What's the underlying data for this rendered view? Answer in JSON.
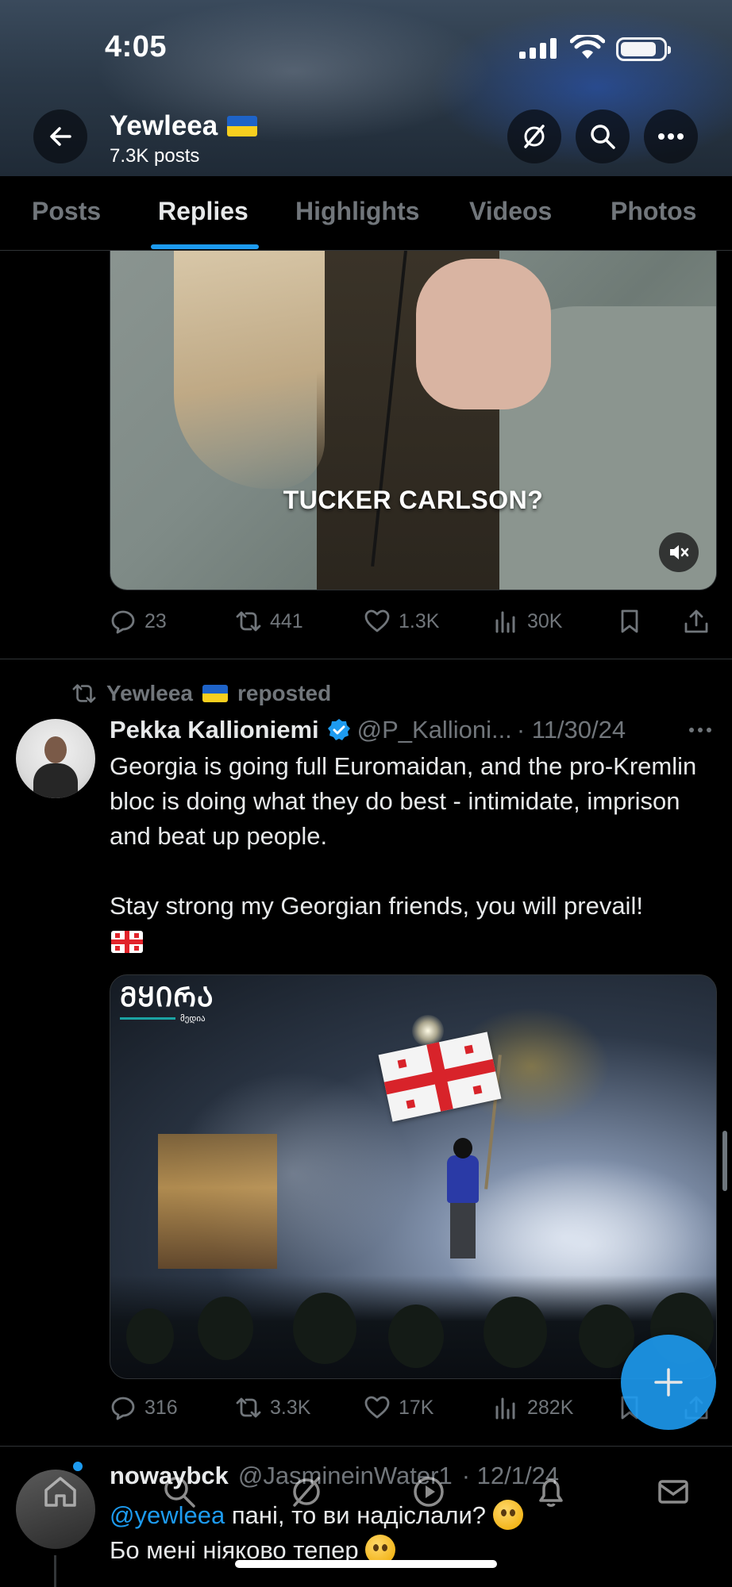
{
  "status_bar": {
    "time": "4:05"
  },
  "profile": {
    "name": "Yewleea",
    "posts_count": "7.3K posts"
  },
  "tabs": [
    {
      "label": "Posts",
      "active": false
    },
    {
      "label": "Replies",
      "active": true
    },
    {
      "label": "Highlights",
      "active": false
    },
    {
      "label": "Videos",
      "active": false
    },
    {
      "label": "Photos",
      "active": false
    }
  ],
  "post1": {
    "video_caption": "TUCKER CARLSON?",
    "replies": "23",
    "reposts": "441",
    "likes": "1.3K",
    "views": "30K"
  },
  "post2": {
    "repost_label": "Yewleea",
    "repost_suffix": "reposted",
    "author": "Pekka Kallioniemi",
    "handle": "@P_Kallioni...",
    "date": "· 11/30/24",
    "text_p1": "Georgia is going full Euromaidan, and the pro-Kremlin bloc is doing what they do best - intimidate, imprison and beat up people.",
    "text_p2": "Stay strong my Georgian friends, you will prevail!",
    "image_logo_text": "ᲛᲧᲘᲠᲐ",
    "image_logo_sub": "მედია",
    "replies": "316",
    "reposts": "3.3K",
    "likes": "17K",
    "views": "282K"
  },
  "post3": {
    "author": "nowaybck",
    "handle": "@JasmineinWater1",
    "date": "· 12/1/24",
    "mention": "@yewleea",
    "line1_rest": " пані, то ви надіслали?",
    "line2": "Бо мені ніяково тепер"
  },
  "colors": {
    "accent": "#1d9bf0",
    "text_primary": "#e7e9ea",
    "text_secondary": "#71767b",
    "background": "#000000"
  },
  "icons": [
    "back-arrow-icon",
    "grok-icon",
    "search-icon",
    "more-icon",
    "mute-icon",
    "reply-icon",
    "repost-icon",
    "like-icon",
    "views-icon",
    "bookmark-icon",
    "share-icon",
    "verified-icon",
    "home-icon",
    "explore-icon",
    "grok-nav-icon",
    "video-icon",
    "notifications-icon",
    "messages-icon",
    "compose-icon"
  ]
}
